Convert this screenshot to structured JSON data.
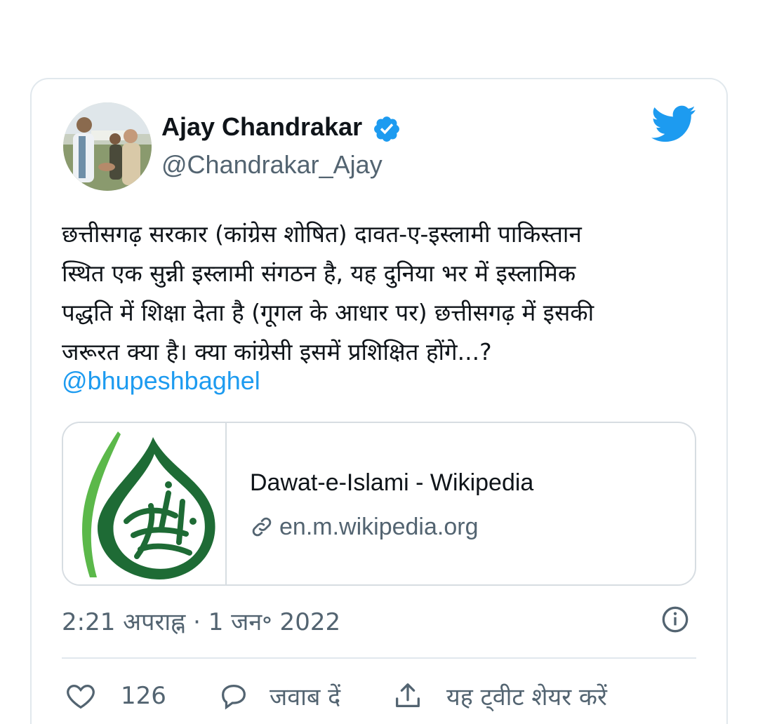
{
  "author": {
    "name": "Ajay Chandrakar",
    "handle": "@Chandrakar_Ajay",
    "verified": true
  },
  "tweet": {
    "lines": [
      "छत्तीसगढ़ सरकार (कांग्रेस शोषित) दावत-ए-इस्लामी पाकिस्तान",
      "स्थित एक सुन्नी इस्लामी संगठन है, यह दुनिया भर में इस्लामिक",
      "पद्धति में शिक्षा देता है (गूगल के आधार पर) छत्तीसगढ़ में इसकी",
      "जरूरत क्या है। क्या कांग्रेसी इसमें प्रशिक्षित होंगे...?"
    ],
    "mention": "@bhupeshbaghel"
  },
  "link_card": {
    "title": "Dawat-e-Islami - Wikipedia",
    "domain": "en.m.wikipedia.org"
  },
  "timestamp": "2:21 अपराह्न · 1 जन॰ 2022",
  "actions": {
    "like_count": "126",
    "reply_label": "जवाब दें",
    "share_label": "यह ट्वीट शेयर करें"
  },
  "colors": {
    "accent": "#1d9bf0",
    "text": "#0f1419",
    "secondary": "#536471",
    "border": "#e1e8ed",
    "logo_green_dark": "#1e6b35",
    "logo_green_light": "#5bb84a"
  },
  "icons": [
    "avatar-photo",
    "verified-badge-icon",
    "twitter-bird-icon",
    "link-icon",
    "info-icon",
    "heart-icon",
    "reply-bubble-icon",
    "share-icon"
  ]
}
